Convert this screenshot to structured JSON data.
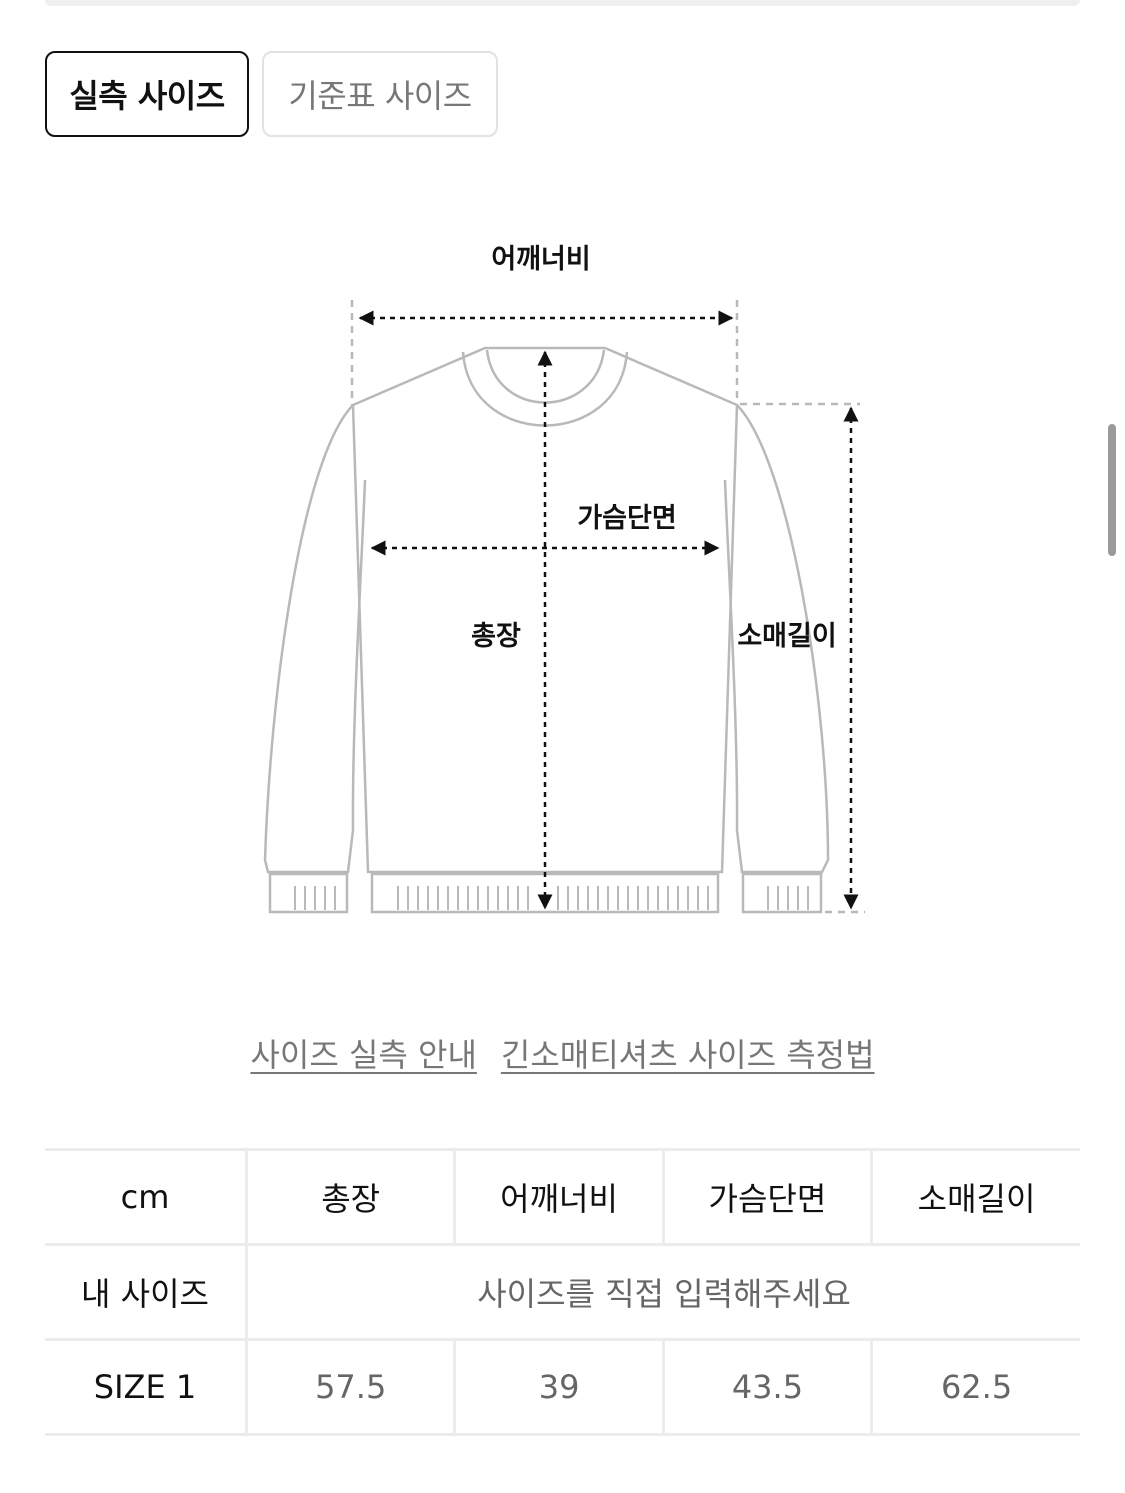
{
  "tabs": {
    "actual": "실측 사이즈",
    "standard": "기준표 사이즈"
  },
  "diagram": {
    "shoulder": "어깨너비",
    "chest": "가슴단면",
    "length": "총장",
    "sleeve": "소매길이"
  },
  "links": {
    "guide": "사이즈 실측 안내",
    "method": "긴소매티셔츠 사이즈 측정법"
  },
  "table": {
    "unit": "cm",
    "columns": [
      "총장",
      "어깨너비",
      "가슴단면",
      "소매길이"
    ],
    "my_size_label": "내 사이즈",
    "my_size_prompt": "사이즈를 직접 입력해주세요",
    "rows": [
      {
        "size": "SIZE 1",
        "values": [
          "57.5",
          "39",
          "43.5",
          "62.5"
        ]
      }
    ]
  }
}
